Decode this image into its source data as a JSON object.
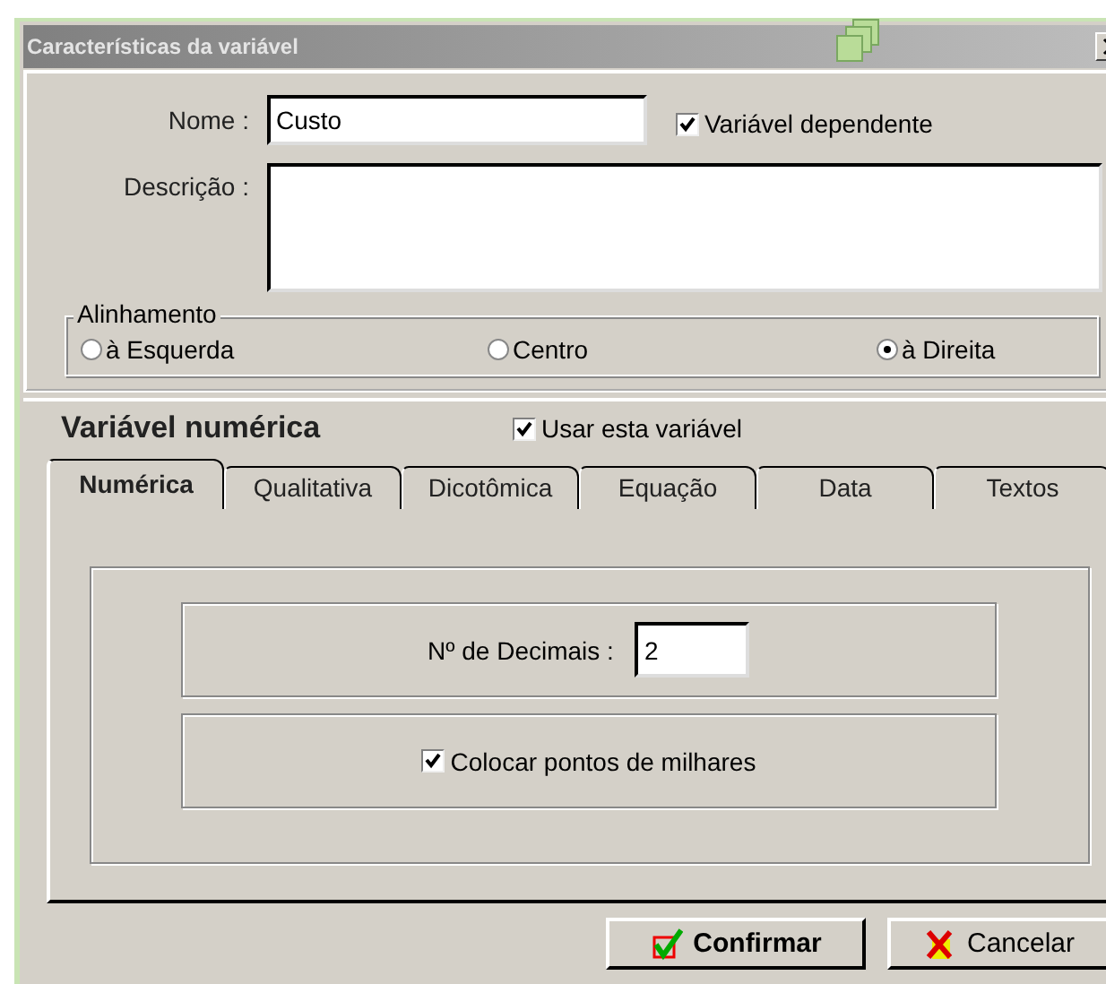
{
  "window": {
    "title": "Características da variável"
  },
  "name_field": {
    "label": "Nome :",
    "value": "Custo"
  },
  "dependent": {
    "label": "Variável dependente",
    "checked": true
  },
  "description_field": {
    "label": "Descrição :"
  },
  "alignment": {
    "title": "Alinhamento",
    "options": [
      {
        "label": "à Esquerda",
        "selected": false
      },
      {
        "label": "Centro",
        "selected": false
      },
      {
        "label": "à Direita",
        "selected": true
      }
    ]
  },
  "section": {
    "title": "Variável numérica",
    "use_label": "Usar esta variável",
    "use_checked": true
  },
  "tabs": [
    {
      "label": "Numérica",
      "selected": true
    },
    {
      "label": "Qualitativa",
      "selected": false
    },
    {
      "label": "Dicotômica",
      "selected": false
    },
    {
      "label": "Equação",
      "selected": false
    },
    {
      "label": "Data",
      "selected": false
    },
    {
      "label": "Textos",
      "selected": false
    }
  ],
  "panel": {
    "decimals_label": "Nº de Decimais :",
    "decimals_value": "2",
    "thousands_label": "Colocar pontos de milhares",
    "thousands_checked": true
  },
  "buttons": [
    {
      "label": "Confirmar",
      "kind": "confirm"
    },
    {
      "label": "Cancelar",
      "kind": "cancel"
    }
  ]
}
